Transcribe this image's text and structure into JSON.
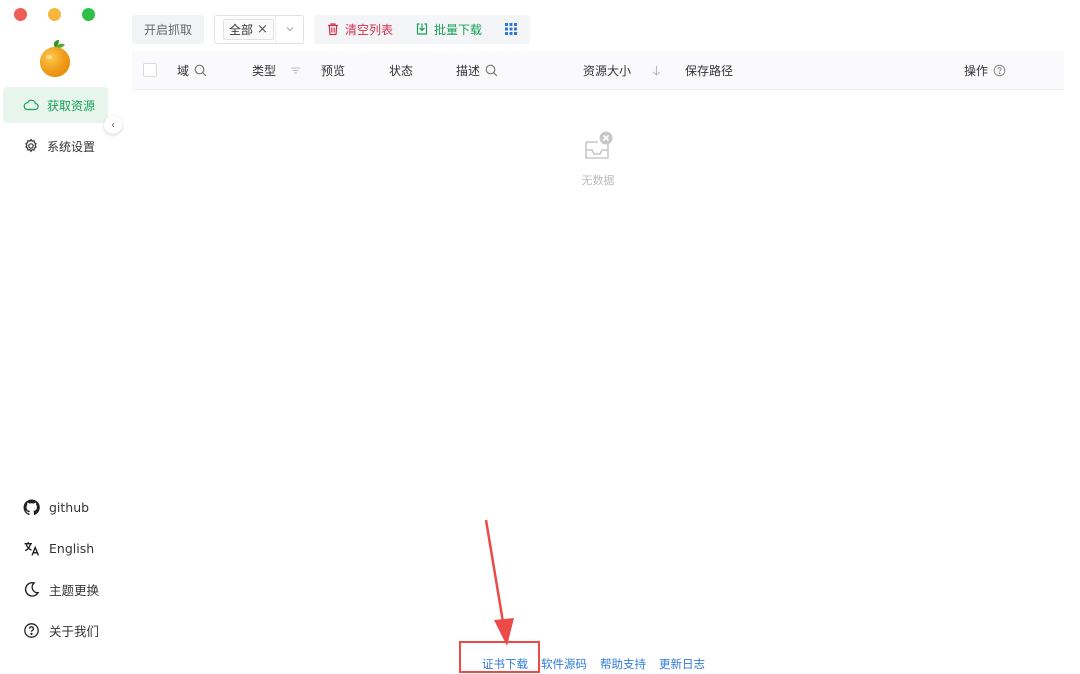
{
  "sidebar": {
    "nav": [
      {
        "label": "获取资源",
        "icon": "cloud-icon",
        "active": true
      },
      {
        "label": "系统设置",
        "icon": "gear-icon",
        "active": false
      }
    ],
    "bottom": [
      {
        "label": "github",
        "icon": "github-icon"
      },
      {
        "label": "English",
        "icon": "translate-icon"
      },
      {
        "label": "主题更换",
        "icon": "moon-icon"
      },
      {
        "label": "关于我们",
        "icon": "help-icon"
      }
    ]
  },
  "toolbar": {
    "capture_label": "开启抓取",
    "filter_tag": "全部",
    "clear_label": "清空列表",
    "batch_download_label": "批量下载"
  },
  "table": {
    "columns": [
      "域",
      "类型",
      "预览",
      "状态",
      "描述",
      "资源大小",
      "保存路径",
      "操作"
    ],
    "empty_text": "无数据"
  },
  "footer": {
    "links": [
      "证书下载",
      "软件源码",
      "帮助支持",
      "更新日志"
    ]
  },
  "colors": {
    "accent_green": "#18a058",
    "danger_red": "#d03050",
    "link_blue": "#2f7ad8",
    "annotation_red": "#ea4b48"
  }
}
